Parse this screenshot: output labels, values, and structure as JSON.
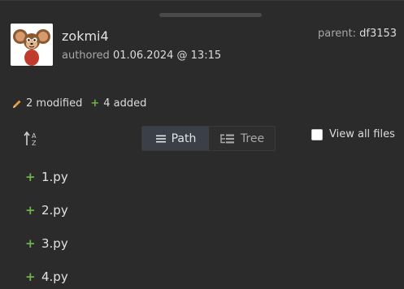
{
  "commit": {
    "author": "zokmi4",
    "authored_label": "authored",
    "authored_date": "01.06.2024 @ 13:15",
    "parent_label": "parent:",
    "parent_hash": "df3153"
  },
  "summary": {
    "modified_text": "2 modified",
    "added_text": "4 added"
  },
  "view_toggle": {
    "path_label": "Path",
    "tree_label": "Tree",
    "selected": "Path"
  },
  "view_all_files_label": "View all files",
  "files": [
    {
      "status": "+",
      "name": "1.py"
    },
    {
      "status": "+",
      "name": "2.py"
    },
    {
      "status": "+",
      "name": "3.py"
    },
    {
      "status": "+",
      "name": "4.py"
    }
  ],
  "colors": {
    "background": "#2b2b2b",
    "added": "#6fb34a",
    "modified": "#e0a03c",
    "selected_tab": "#3a3f48"
  },
  "icons": {
    "avatar": "cheburashka-avatar",
    "modified": "pencil-icon",
    "sort": "sort-alpha-icon",
    "path": "list-icon",
    "tree": "tree-icon"
  }
}
